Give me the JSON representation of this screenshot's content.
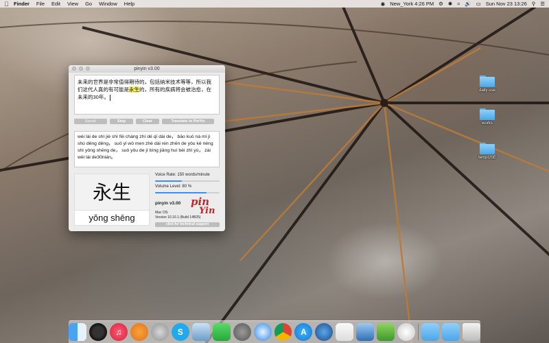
{
  "menubar": {
    "items": [
      "Finder",
      "File",
      "Edit",
      "View",
      "Go",
      "Window",
      "Help"
    ],
    "clock_location": "New_York 4:26 PM",
    "datetime": "Sun Nov 23  13:26"
  },
  "window": {
    "title": "pinyin v3.00",
    "input_text_before": "未来的世界是非常值得期待的，包括纳米技术等等，所以我们这代人真的有可能是",
    "input_text_highlight": "永生",
    "input_text_after": "的，所有的疾病将会被治愈，在未来的30年。",
    "buttons": {
      "speak": "Speak",
      "stop": "Stop",
      "clear": "Clear",
      "translate": "Translate to PinYin"
    },
    "output_text": "wèi lái de shì jiè shì fēi cháng zhí dé qī dài de， bāo kuò nà mǐ jì shù děng děng， suǒ yǐ wǒ men zhè dài rén zhēn de yǒu kě néng shì yǒng shēng de， suǒ yǒu de jí bìng jiāng huì bèi zhì yù， zài wèi lái de30nián。",
    "big_chars": "永生",
    "big_pinyin": "yǒng shēng",
    "voice_rate_label": "Voice Rate: 150 words/minute",
    "voice_rate_fraction": 0.42,
    "volume_label": "Volume Level: 80 %",
    "volume_fraction": 0.8,
    "app_name": "pinyin v3.00",
    "logo_top": "pin",
    "logo_bottom": "Yin",
    "os_label": "Mac OS:",
    "version": "Version 10.10.1 (Build 14B25)",
    "support_button": "click for technical support"
  },
  "desktop": {
    "folders": [
      {
        "label": "daily use"
      },
      {
        "label": "works"
      },
      {
        "label": "tempUSE"
      }
    ]
  },
  "dock": {
    "icons": [
      "finder-icon",
      "dashboard-icon",
      "music-icon",
      "books-icon",
      "launchpad-icon",
      "skype-icon",
      "preview-icon",
      "facetime-icon",
      "system-preferences-icon",
      "safari-icon",
      "chrome-icon",
      "app-store-icon",
      "google-earth-icon",
      "textedit-icon",
      "xcode-icon",
      "numbers-icon",
      "pinyin-app-icon",
      "downloads-folder-icon",
      "applications-folder-icon",
      "trash-icon"
    ]
  }
}
